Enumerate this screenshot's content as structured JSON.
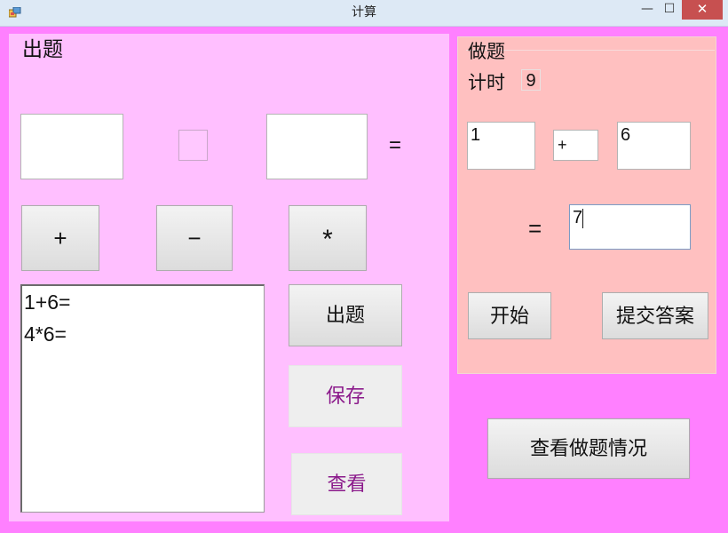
{
  "window": {
    "title": "计算",
    "minimize_glyph": "—",
    "maximize_glyph": "☐",
    "close_glyph": "✕"
  },
  "left_panel": {
    "title": "出题",
    "operand1": "",
    "operator": "",
    "operand2": "",
    "equals": "=",
    "op_buttons": {
      "plus": "+",
      "minus": "−",
      "times": "*"
    },
    "question_list": [
      "1+6=",
      "4*6="
    ],
    "generate_button": "出题",
    "save_button": "保存",
    "view_button": "查看"
  },
  "right_panel": {
    "title": "做题",
    "timer_label": "计时",
    "timer_value": "9",
    "operand1": "1",
    "operator": "+",
    "operand2": "6",
    "equals": "=",
    "answer": "7",
    "start_button": "开始",
    "submit_button": "提交答案"
  },
  "view_results_button": "查看做题情况",
  "colors": {
    "window_bg": "#ff80ff",
    "left_panel_bg": "#ffbfff",
    "right_panel_bg": "#ffc0c0",
    "titlebar_bg": "#dde9f5",
    "close_button_bg": "#c75050",
    "flat_button_text": "#8b1a8b"
  },
  "icons": [
    "app-icon",
    "minimize-icon",
    "maximize-icon",
    "close-icon"
  ]
}
